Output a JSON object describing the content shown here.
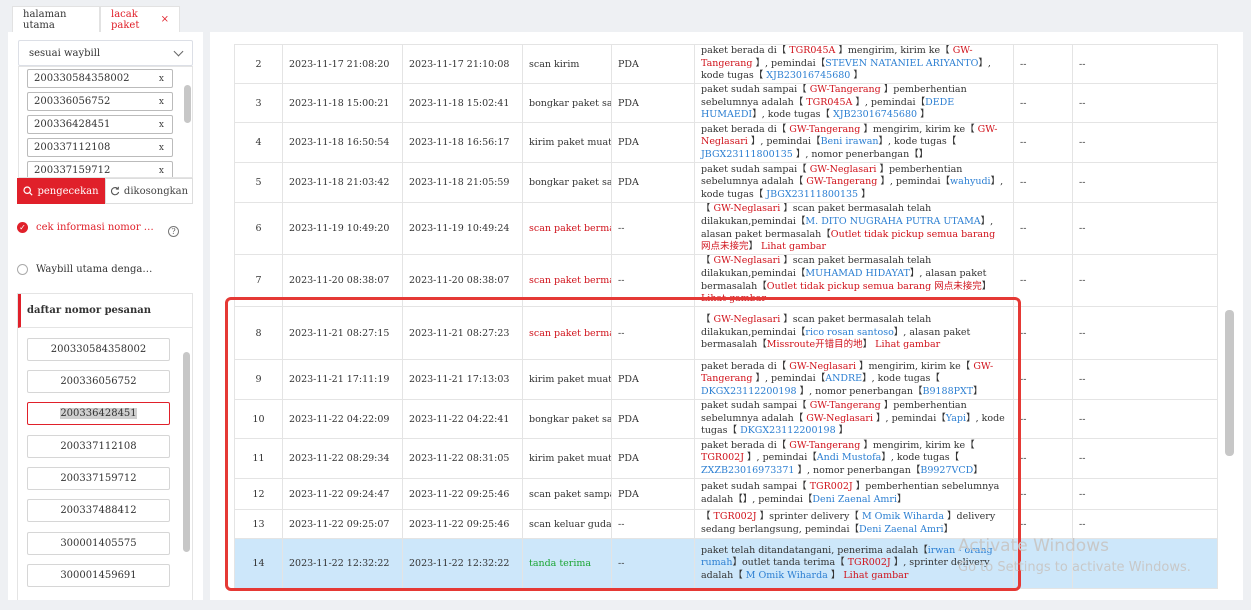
{
  "tabs": [
    {
      "label": "halaman utama"
    },
    {
      "label": "lacak paket",
      "close": "×"
    }
  ],
  "search": {
    "mode": "sesuai waybill",
    "waybills": [
      "200330584358002",
      "200336056752",
      "200336428451",
      "200337112108",
      "200337159712"
    ],
    "clear_glyph": "x",
    "search_label": "pengecekan",
    "clear_label": "dikosongkan"
  },
  "options": {
    "opt1": "cek informasi nomor …",
    "opt1_check": "✓",
    "help": "?",
    "opt2": "Waybill utama denga…"
  },
  "orders": {
    "title": "daftar nomor pesanan",
    "items": [
      "200330584358002",
      "200336056752",
      "200336428451",
      "200337112108",
      "200337159712",
      "200337488412",
      "300001405575",
      "300001459691"
    ]
  },
  "rows": [
    {
      "no": "2",
      "t1": "2023-11-17 21:08:20",
      "t2": "2023-11-17 21:10:08",
      "act": "scan kirim",
      "dev": "PDA",
      "info": [
        [
          "paket berada di【 ",
          ""
        ],
        [
          "TGR045A",
          "red"
        ],
        [
          " 】mengirim, kirim ke【 ",
          ""
        ],
        [
          "GW-Tangerang",
          "red"
        ],
        [
          " 】, pemindai【",
          ""
        ],
        [
          "STEVEN NATANIEL ARIYANTO",
          "blue"
        ],
        [
          "】, kode tugas【 ",
          ""
        ],
        [
          "XJB23016745680",
          "blue"
        ],
        [
          " 】",
          ""
        ]
      ],
      "c7": "--",
      "c8": "--"
    },
    {
      "no": "3",
      "t1": "2023-11-18 15:00:21",
      "t2": "2023-11-18 15:02:41",
      "act": "bongkar paket samp",
      "dev": "PDA",
      "info": [
        [
          "paket sudah sampai【 ",
          ""
        ],
        [
          "GW-Tangerang",
          "red"
        ],
        [
          " 】pemberhentian sebelumnya adalah【 ",
          ""
        ],
        [
          "TGR045A",
          "red"
        ],
        [
          " 】, pemindai【",
          ""
        ],
        [
          "DEDE HUMAEDI",
          "blue"
        ],
        [
          "】, kode tugas【 ",
          ""
        ],
        [
          "XJB23016745680",
          "blue"
        ],
        [
          " 】",
          ""
        ]
      ],
      "c7": "--",
      "c8": "--"
    },
    {
      "no": "4",
      "t1": "2023-11-18 16:50:54",
      "t2": "2023-11-18 16:56:17",
      "act": "kirim paket muatan",
      "dev": "PDA",
      "info": [
        [
          "paket berada di【 ",
          ""
        ],
        [
          "GW-Tangerang",
          "red"
        ],
        [
          " 】mengirim, kirim ke【 ",
          ""
        ],
        [
          "GW-Neglasari",
          "red"
        ],
        [
          " 】, pemindai【",
          ""
        ],
        [
          "Beni irawan",
          "blue"
        ],
        [
          "】, kode tugas【 ",
          ""
        ],
        [
          "JBGX23111800135",
          "blue"
        ],
        [
          " 】, nomor penerbangan【】",
          ""
        ]
      ],
      "c7": "--",
      "c8": "--"
    },
    {
      "no": "5",
      "t1": "2023-11-18 21:03:42",
      "t2": "2023-11-18 21:05:59",
      "act": "bongkar paket samp",
      "dev": "PDA",
      "info": [
        [
          "paket sudah sampai【 ",
          ""
        ],
        [
          "GW-Neglasari",
          "red"
        ],
        [
          " 】pemberhentian sebelumnya adalah【 ",
          ""
        ],
        [
          "GW-Tangerang",
          "red"
        ],
        [
          " 】, pemindai【",
          ""
        ],
        [
          "wahyudi",
          "blue"
        ],
        [
          "】, kode tugas【 ",
          ""
        ],
        [
          "JBGX23111800135",
          "blue"
        ],
        [
          " 】",
          ""
        ]
      ],
      "c7": "--",
      "c8": "--"
    },
    {
      "no": "6",
      "t1": "2023-11-19 10:49:20",
      "t2": "2023-11-19 10:49:24",
      "act": "scan paket bermasa",
      "actc": "red",
      "dev": "--",
      "info": [
        [
          "【 ",
          ""
        ],
        [
          "GW-Neglasari",
          "red"
        ],
        [
          " 】scan paket bermasalah telah dilakukan,pemindai【",
          ""
        ],
        [
          "M. DITO NUGRAHA PUTRA UTAMA",
          "blue"
        ],
        [
          "】, alasan paket bermasalah【",
          ""
        ],
        [
          "Outlet tidak pickup semua barang 网点未接完",
          "red"
        ],
        [
          "】 ",
          ""
        ],
        [
          "Lihat gambar",
          "red"
        ]
      ],
      "c7": "--",
      "c8": "--"
    },
    {
      "no": "7",
      "t1": "2023-11-20 08:38:07",
      "t2": "2023-11-20 08:38:07",
      "act": "scan paket bermasa",
      "actc": "red",
      "dev": "--",
      "info": [
        [
          "【 ",
          ""
        ],
        [
          "GW-Neglasari",
          "red"
        ],
        [
          " 】scan paket bermasalah telah dilakukan,pemindai【",
          ""
        ],
        [
          "MUHAMAD HIDAYAT",
          "blue"
        ],
        [
          "】, alasan paket bermasalah【",
          ""
        ],
        [
          "Outlet tidak pickup semua barang 网点未接完",
          "red"
        ],
        [
          "】 ",
          ""
        ],
        [
          "Lihat gambar",
          "red"
        ]
      ],
      "c7": "--",
      "c8": "--"
    },
    {
      "no": "8",
      "t1": "2023-11-21 08:27:15",
      "t2": "2023-11-21 08:27:23",
      "act": "scan paket bermasa",
      "actc": "red",
      "dev": "--",
      "info": [
        [
          "【 ",
          ""
        ],
        [
          "GW-Neglasari",
          "red"
        ],
        [
          " 】scan paket bermasalah telah dilakukan,pemindai【",
          ""
        ],
        [
          "rico rosan santoso",
          "blue"
        ],
        [
          "】, alasan paket bermasalah【",
          ""
        ],
        [
          "Missroute开错目的地",
          "red"
        ],
        [
          "】 ",
          ""
        ],
        [
          "Lihat gambar",
          "red"
        ]
      ],
      "c7": "--",
      "c8": "--"
    },
    {
      "no": "9",
      "t1": "2023-11-21 17:11:19",
      "t2": "2023-11-21 17:13:03",
      "act": "kirim paket muatan",
      "dev": "PDA",
      "info": [
        [
          "paket berada di【 ",
          ""
        ],
        [
          "GW-Neglasari",
          "red"
        ],
        [
          " 】mengirim, kirim ke【 ",
          ""
        ],
        [
          "GW-Tangerang",
          "red"
        ],
        [
          " 】, pemindai【",
          ""
        ],
        [
          "ANDRE",
          "blue"
        ],
        [
          "】, kode tugas【 ",
          ""
        ],
        [
          "DKGX23112200198",
          "blue"
        ],
        [
          " 】, nomor penerbangan【",
          ""
        ],
        [
          "B9188PXT",
          "blue"
        ],
        [
          "】",
          ""
        ]
      ],
      "c7": "--",
      "c8": "--"
    },
    {
      "no": "10",
      "t1": "2023-11-22 04:22:09",
      "t2": "2023-11-22 04:22:41",
      "act": "bongkar paket samp",
      "dev": "PDA",
      "info": [
        [
          "paket sudah sampai【 ",
          ""
        ],
        [
          "GW-Tangerang",
          "red"
        ],
        [
          " 】pemberhentian sebelumnya adalah【 ",
          ""
        ],
        [
          "GW-Neglasari",
          "red"
        ],
        [
          " 】, pemindai【",
          ""
        ],
        [
          "Yapi",
          "blue"
        ],
        [
          "】, kode tugas【 ",
          ""
        ],
        [
          "DKGX23112200198",
          "blue"
        ],
        [
          " 】",
          ""
        ]
      ],
      "c7": "--",
      "c8": "--"
    },
    {
      "no": "11",
      "t1": "2023-11-22 08:29:34",
      "t2": "2023-11-22 08:31:05",
      "act": "kirim paket muatan",
      "dev": "PDA",
      "info": [
        [
          "paket berada di【 ",
          ""
        ],
        [
          "GW-Tangerang",
          "red"
        ],
        [
          " 】mengirim, kirim ke【 ",
          ""
        ],
        [
          "TGR002J",
          "red"
        ],
        [
          " 】, pemindai【",
          ""
        ],
        [
          "Andi Mustofa",
          "blue"
        ],
        [
          "】, kode tugas【 ",
          ""
        ],
        [
          "ZXZB23016973371",
          "blue"
        ],
        [
          " 】, nomor penerbangan【",
          ""
        ],
        [
          "B9927VCD",
          "blue"
        ],
        [
          "】",
          ""
        ]
      ],
      "c7": "--",
      "c8": "--"
    },
    {
      "no": "12",
      "t1": "2023-11-22 09:24:47",
      "t2": "2023-11-22 09:25:46",
      "act": "scan paket sampai",
      "dev": "PDA",
      "info": [
        [
          "paket sudah sampai【 ",
          ""
        ],
        [
          "TGR002J",
          "red"
        ],
        [
          " 】pemberhentian sebelumnya adalah【】, pemindai【",
          ""
        ],
        [
          "Deni Zaenal Amri",
          "blue"
        ],
        [
          "】",
          ""
        ]
      ],
      "c7": "--",
      "c8": "--"
    },
    {
      "no": "13",
      "t1": "2023-11-22 09:25:07",
      "t2": "2023-11-22 09:25:46",
      "act": "scan keluar gudang",
      "dev": "--",
      "info": [
        [
          "【 ",
          ""
        ],
        [
          "TGR002J",
          "red"
        ],
        [
          " 】sprinter delivery【 ",
          ""
        ],
        [
          "M Omik Wiharda",
          "blue"
        ],
        [
          " 】delivery sedang berlangsung, pemindai【",
          ""
        ],
        [
          "Deni Zaenal Amri",
          "blue"
        ],
        [
          "】",
          ""
        ]
      ],
      "c7": "--",
      "c8": "--"
    },
    {
      "no": "14",
      "t1": "2023-11-22 12:32:22",
      "t2": "2023-11-22 12:32:22",
      "act": "tanda terima",
      "actc": "green",
      "dev": "--",
      "hl": true,
      "info": [
        [
          "paket telah ditandatangani, penerima adalah【",
          ""
        ],
        [
          "irwan - orang rumah",
          "blue"
        ],
        [
          "】outlet tanda terima【 ",
          ""
        ],
        [
          "TGR002J",
          "red"
        ],
        [
          " 】, sprinter delivery adalah【 ",
          ""
        ],
        [
          "M Omik Wiharda",
          "blue"
        ],
        [
          " 】 ",
          ""
        ],
        [
          "Lihat gambar",
          "red"
        ]
      ],
      "c7": "",
      "c8": ""
    }
  ],
  "watermark": {
    "line1": "Activate Windows",
    "line2": "Go to Settings to activate Windows."
  },
  "colors": {
    "accent": "#e0202a",
    "link": "#2c7fd2",
    "highlight": "#cde7fa",
    "success": "#1aa533"
  }
}
